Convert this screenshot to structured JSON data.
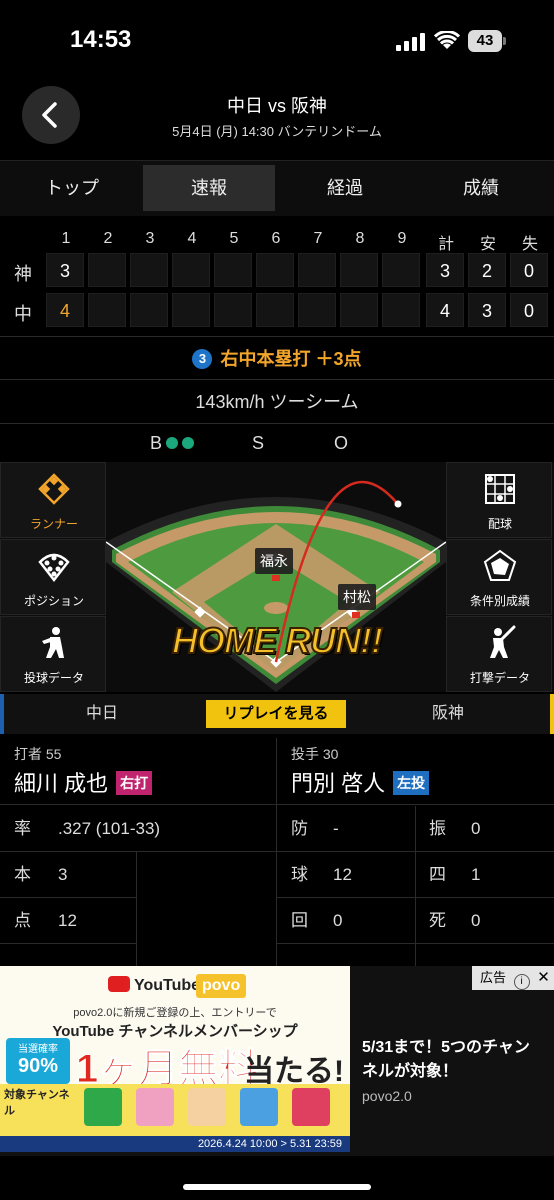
{
  "status": {
    "time": "14:53",
    "battery": "43"
  },
  "header": {
    "title": "中日 vs 阪神",
    "subtitle": "5月4日 (月) 14:30 バンテリンドーム"
  },
  "tabs": [
    "トップ",
    "速報",
    "経過",
    "成績"
  ],
  "active_tab": "速報",
  "scoreboard": {
    "headers": [
      "1",
      "2",
      "3",
      "4",
      "5",
      "6",
      "7",
      "8",
      "9",
      "計",
      "安",
      "失"
    ],
    "rows": [
      {
        "team": "神",
        "innings": [
          "3",
          "",
          "",
          "",
          "",
          "",
          "",
          "",
          ""
        ],
        "totals": [
          "3",
          "2",
          "0"
        ]
      },
      {
        "team": "中",
        "innings": [
          "4",
          "",
          "",
          "",
          "",
          "",
          "",
          "",
          ""
        ],
        "totals": [
          "4",
          "3",
          "0"
        ]
      }
    ]
  },
  "play": {
    "num": "3",
    "text": "右中本塁打 ＋3点"
  },
  "pitch": "143km/h ツーシーム",
  "count": {
    "b": "B",
    "s": "S",
    "o": "O",
    "balls": 2
  },
  "side_left": [
    {
      "label": "ランナー",
      "icon": "runner-diamond-icon"
    },
    {
      "label": "ポジション",
      "icon": "position-icon"
    },
    {
      "label": "投球データ",
      "icon": "pitcher-icon"
    }
  ],
  "side_right": [
    {
      "label": "配球",
      "icon": "strike-zone-icon"
    },
    {
      "label": "条件別成績",
      "icon": "radar-icon"
    },
    {
      "label": "打撃データ",
      "icon": "batter-icon"
    }
  ],
  "field": {
    "fielder1": "福永",
    "fielder2": "村松",
    "banner": "HOME RUN!!"
  },
  "teambar": {
    "left": "中日",
    "replay": "リプレイを見る",
    "right": "阪神"
  },
  "batter": {
    "role": "打者 55",
    "name": "細川 成也",
    "hand": "右打",
    "stats": [
      {
        "k": "率",
        "v": ".327 (101-33)"
      },
      {
        "k": "本",
        "v": "3"
      },
      {
        "k": "点",
        "v": "12"
      }
    ]
  },
  "pitcher": {
    "role": "投手 30",
    "name": "門別 啓人",
    "hand": "左投",
    "stats": [
      {
        "k": "防",
        "v": "-",
        "k2": "振",
        "v2": "0"
      },
      {
        "k": "球",
        "v": "12",
        "k2": "四",
        "v2": "1"
      },
      {
        "k": "回",
        "v": "0",
        "k2": "死",
        "v2": "0"
      }
    ]
  },
  "ad": {
    "label": "広告",
    "brand1": "YouTube",
    "brand2": "povo",
    "line1": "povo2.0に新規ご登録の上、エントリーで",
    "line2": "YouTube チャンネルメンバーシップ",
    "rate_label": "当選確率",
    "rate": "90%",
    "headline": "1ヶ月無料",
    "headline2": "当たる!",
    "target": "対象チャンネル",
    "dates": "2026.4.24 10:00 > 5.31 23:59",
    "text": "5/31まで！5つのチャンネルが対象！",
    "source": "povo2.0",
    "colors": {
      "accent": "#f2a52b",
      "replay": "#f2c30e",
      "blue": "#1e74c8"
    }
  }
}
